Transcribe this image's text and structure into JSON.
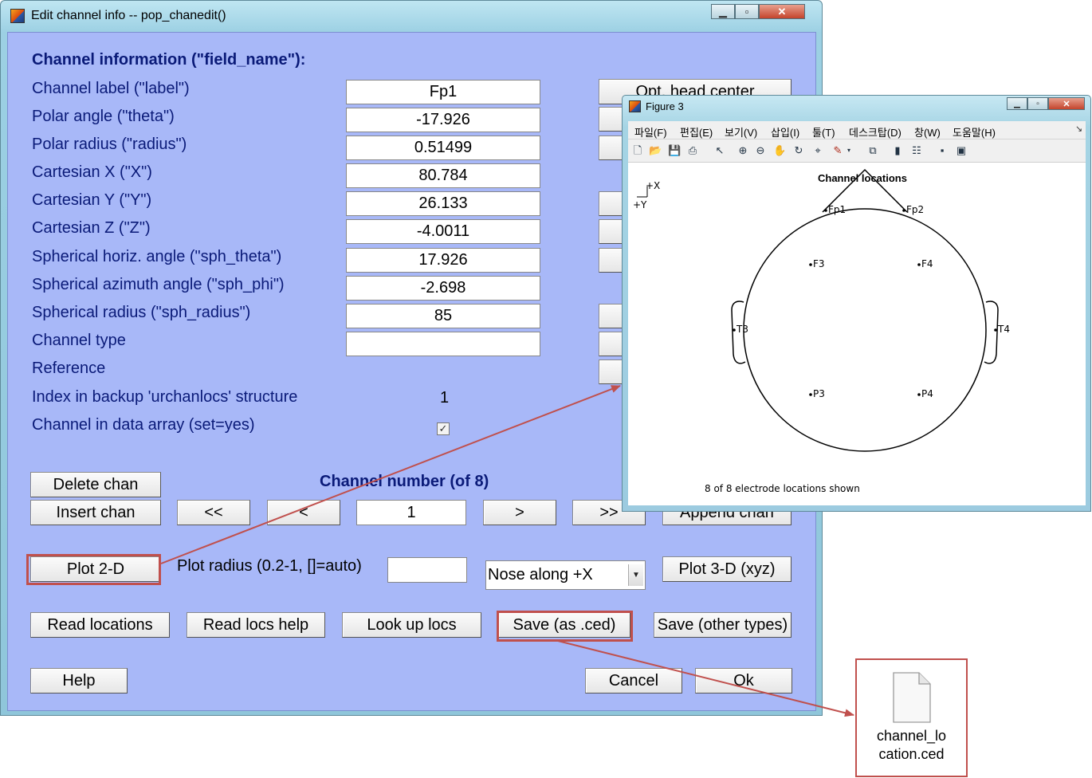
{
  "dialog": {
    "title": "Edit channel info -- pop_chanedit()",
    "section_header": "Channel information (\"field_name\"):",
    "fields": [
      {
        "label": "Channel label (\"label\")",
        "value": "Fp1"
      },
      {
        "label": "Polar angle (\"theta\")",
        "value": "-17.926"
      },
      {
        "label": "Polar radius (\"radius\")",
        "value": "0.51499"
      },
      {
        "label": "Cartesian X (\"X\")",
        "value": "80.784"
      },
      {
        "label": "Cartesian Y (\"Y\")",
        "value": "26.133"
      },
      {
        "label": "Cartesian Z (\"Z\")",
        "value": "-4.0011"
      },
      {
        "label": "Spherical horiz. angle (\"sph_theta\")",
        "value": "17.926"
      },
      {
        "label": "Spherical azimuth angle (\"sph_phi\")",
        "value": "-2.698"
      },
      {
        "label": "Spherical radius (\"sph_radius\")",
        "value": "85"
      },
      {
        "label": "Channel type",
        "value": ""
      },
      {
        "label": "Reference",
        "value": ""
      }
    ],
    "index_label": "Index in backup 'urchanlocs' structure",
    "index_value": "1",
    "in_data_label": "Channel in data array (set=yes)",
    "in_data_checked": true,
    "opt_head_center": "Opt. head center",
    "channel_number_label": "Channel number (of 8)",
    "delete_chan": "Delete chan",
    "insert_chan": "Insert chan",
    "append_chan": "Append chan",
    "nav": {
      "first": "<<",
      "prev": "<",
      "current": "1",
      "next": ">",
      "last": ">>"
    },
    "plot_2d": "Plot 2-D",
    "plot_radius_label": "Plot radius (0.2-1, []=auto)",
    "plot_radius_value": "",
    "nose_select": "Nose along +X",
    "plot_3d": "Plot 3-D (xyz)",
    "read_locations": "Read locations",
    "read_locs_help": "Read locs help",
    "look_up_locs": "Look up locs",
    "save_ced": "Save (as .ced)",
    "save_other": "Save (other types)",
    "help": "Help",
    "cancel": "Cancel",
    "ok": "Ok"
  },
  "figure": {
    "title": "Figure 3",
    "menu": [
      "파일(F)",
      "편집(E)",
      "보기(V)",
      "삽입(I)",
      "툴(T)",
      "데스크탑(D)",
      "창(W)",
      "도움말(H)"
    ],
    "plot_title": "Channel locations",
    "axis_x": "+X",
    "axis_y": "+Y",
    "electrodes": [
      "Fp1",
      "Fp2",
      "F3",
      "F4",
      "T3",
      "T4",
      "P3",
      "P4"
    ],
    "footer": "8 of 8 electrode locations shown"
  },
  "file": {
    "name_line1": "channel_lo",
    "name_line2": "cation.ced"
  },
  "colors": {
    "highlight": "#c0504d",
    "dialog_bg": "#a8b8f8",
    "label_text": "#0a1a78"
  }
}
